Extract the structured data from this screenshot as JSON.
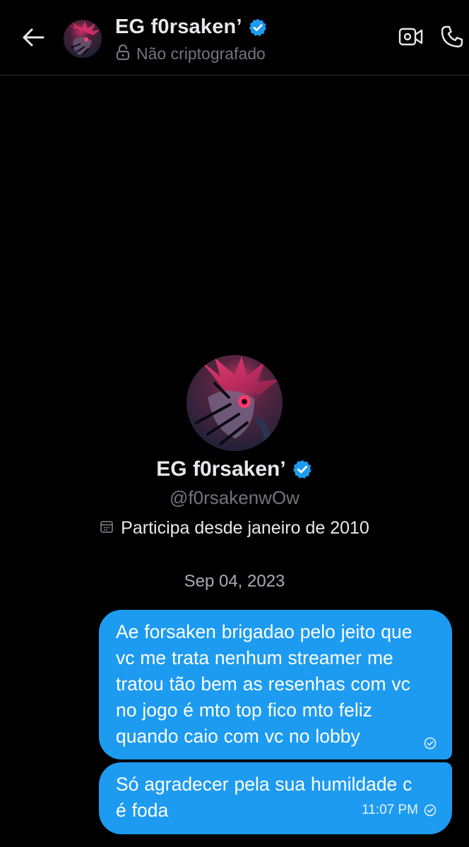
{
  "header": {
    "back_label": "back",
    "name": "EG f0rsaken’",
    "encryption_status": "Não criptografado",
    "video_call_label": "video call",
    "voice_call_label": "voice call"
  },
  "profile": {
    "name": "EG f0rsaken’",
    "handle": "@f0rsakenwOw",
    "joined": "Participa desde janeiro de 2010"
  },
  "conversation": {
    "date_divider": "Sep 04, 2023",
    "messages": [
      {
        "lines": [
          "Ae  forsaken brigadao pelo jeito que",
          "vc me trata nenhum streamer me",
          "tratou tão bem as resenhas com vc",
          "no jogo é mto top fico mto feliz",
          "quando caio com vc no lobby"
        ],
        "time": ""
      },
      {
        "lines": [
          "Só agradecer pela sua humildade c",
          "é foda"
        ],
        "time": "11:07 PM"
      }
    ]
  },
  "colors": {
    "background": "#000000",
    "bubble": "#1d9bf0",
    "verified": "#1d9bf0",
    "secondary_text": "#71767b",
    "avatar_accent": "#e0306b"
  }
}
